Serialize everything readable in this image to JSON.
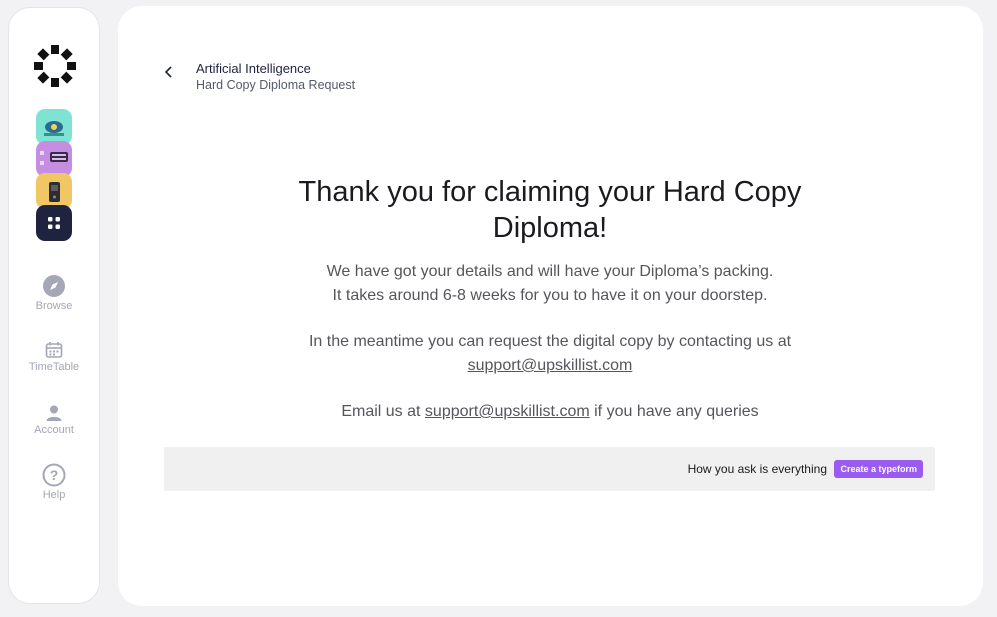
{
  "sidebar": {
    "nav": [
      {
        "label": "Browse",
        "icon": "compass-icon"
      },
      {
        "label": "TimeTable",
        "icon": "calendar-icon"
      },
      {
        "label": "Account",
        "icon": "user-icon"
      },
      {
        "label": "Help",
        "icon": "help-icon"
      }
    ]
  },
  "header": {
    "course": "Artificial Intelligence",
    "page": "Hard Copy Diploma Request"
  },
  "content": {
    "headline": "Thank you for claiming your Hard Copy Diploma!",
    "line1": "We have got your details and will have your Diploma’s packing.",
    "line2": "It takes around 6-8 weeks for you to have it on your doorstep.",
    "line3": "In the meantime you can request the digital copy by contacting us at",
    "email": "support@upskillist.com",
    "email_prefix": "Email us at",
    "email_suffix": "if you have any queries"
  },
  "typeform": {
    "tagline": "How you ask is everything",
    "button": "Create a typeform"
  },
  "colors": {
    "brand_dark": "#1f2340",
    "typeform_purple": "#9a5bf0"
  }
}
